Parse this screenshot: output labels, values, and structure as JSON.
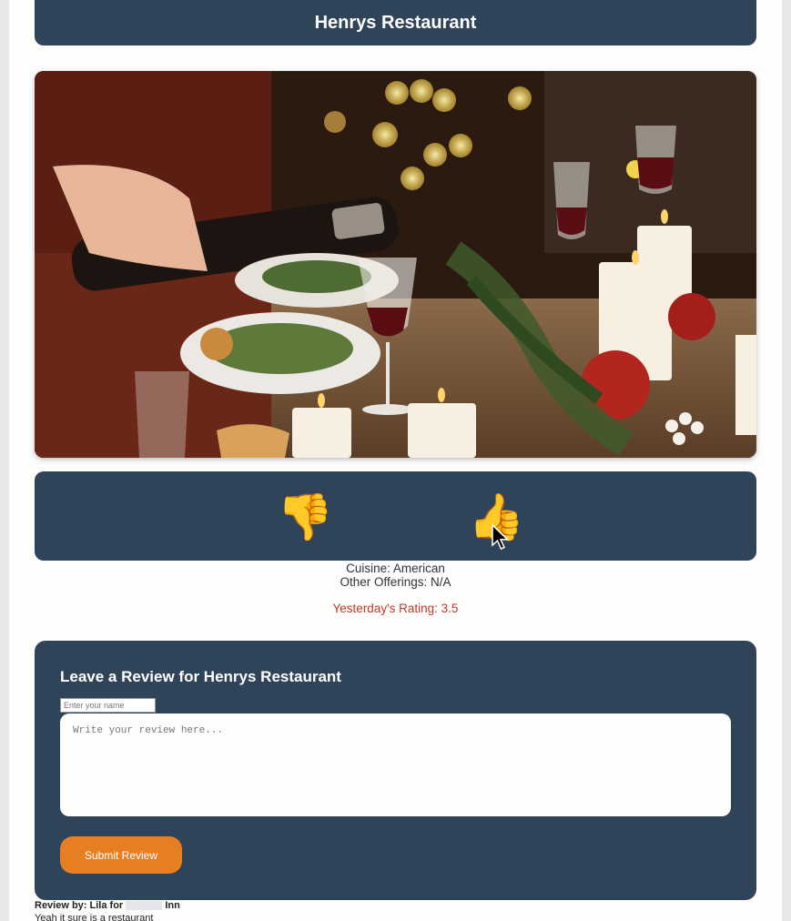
{
  "header": {
    "title": "Henrys Restaurant"
  },
  "photo": {
    "alt": "Dinner table with wine being poured, candles and dishes"
  },
  "votes": {
    "down_icon": "👎",
    "up_icon": "👍"
  },
  "info": {
    "cuisine": "Cuisine: American",
    "other_offerings": "Other Offerings: N/A",
    "rating": "Yesterday's Rating: 3.5"
  },
  "review_form": {
    "heading": "Leave a Review for Henrys Restaurant",
    "name_placeholder": "Enter your name",
    "review_placeholder": "Write your review here...",
    "submit_label": "Submit Review"
  },
  "reviews": [
    {
      "by_prefix": "Review by: Lila for",
      "by_suffix": "Inn",
      "text": "Yeah it sure is a restaurant"
    }
  ],
  "colors": {
    "header": "#2f4459",
    "accent": "#e67e22",
    "rating": "#c0392b"
  }
}
